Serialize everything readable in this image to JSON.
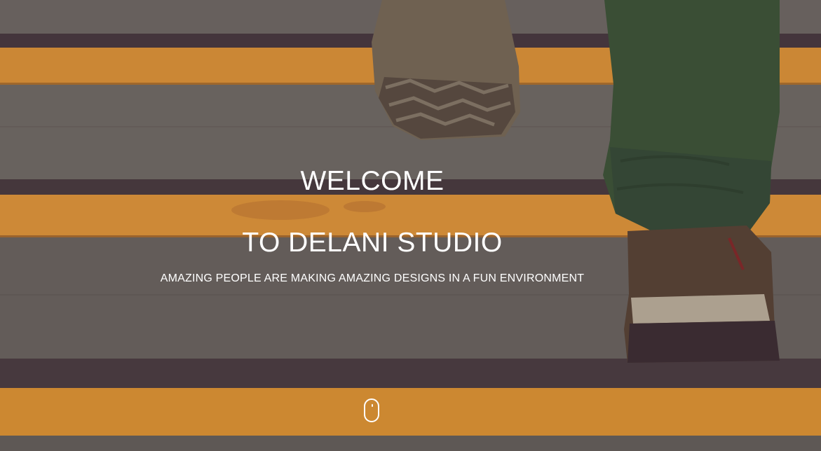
{
  "hero": {
    "title_line_1": "WELCOME",
    "title_line_2": "TO DELANI STUDIO",
    "tagline": "AMAZING PEOPLE ARE MAKING AMAZING DESIGNS IN A FUN ENVIRONMENT",
    "scroll_icon": "mouse-scroll-icon"
  },
  "colors": {
    "text": "#ffffff",
    "stripe": "#f2a33a",
    "step": "#6e6a65",
    "edge": "#4a3a40",
    "pants": "#3f5a3a",
    "shoe": "#5a4636"
  }
}
